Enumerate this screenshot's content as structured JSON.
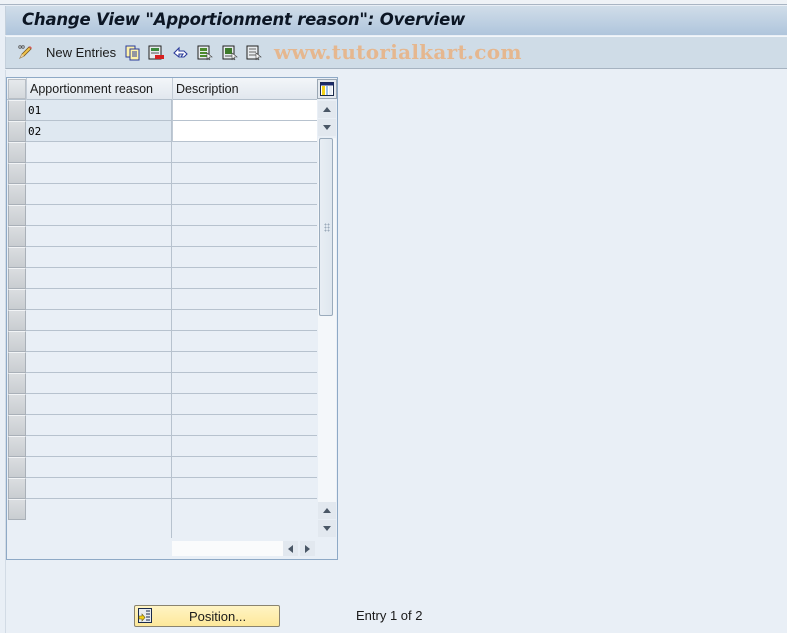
{
  "window": {
    "title": "Change View \"Apportionment reason\": Overview"
  },
  "toolbar": {
    "items": [
      {
        "icon": "edit-pencil-icon",
        "label": ""
      },
      {
        "icon": "new-entries-label",
        "label": "New Entries"
      },
      {
        "icon": "copy-icon",
        "label": ""
      },
      {
        "icon": "delete-icon",
        "label": ""
      },
      {
        "icon": "undo-icon",
        "label": ""
      },
      {
        "icon": "select-all-icon",
        "label": ""
      },
      {
        "icon": "select-block-icon",
        "label": ""
      },
      {
        "icon": "deselect-all-icon",
        "label": ""
      }
    ],
    "new_entries_label": "New Entries",
    "watermark": "www.tutorialkart.com"
  },
  "table": {
    "columns": [
      {
        "key": "reason",
        "label": "Apportionment reason"
      },
      {
        "key": "description",
        "label": "Description"
      }
    ],
    "rows": [
      {
        "reason": "01",
        "description": ""
      },
      {
        "reason": "02",
        "description": ""
      }
    ],
    "empty_rows": 18
  },
  "footer": {
    "position_button": "Position...",
    "entry_info": "Entry 1 of 2"
  },
  "colors": {
    "background": "#e9eff6",
    "title_bar": "#afc5dc",
    "toolbar": "#cfdce7",
    "position_button": "#fde89a",
    "watermark": "#e7b68b"
  }
}
